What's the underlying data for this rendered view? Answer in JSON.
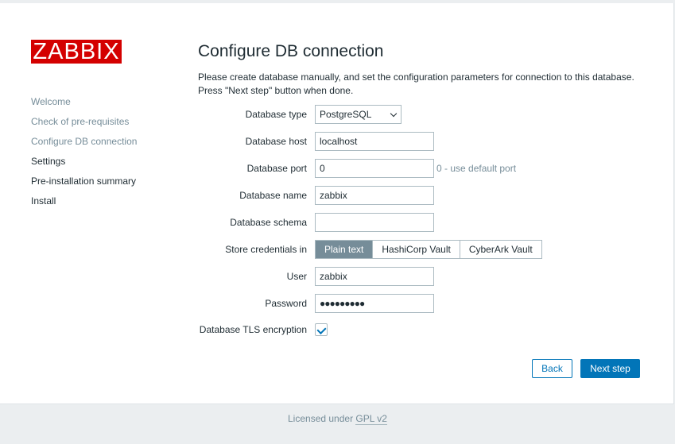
{
  "logo": "ZABBIX",
  "steps": [
    {
      "label": "Welcome",
      "done": true
    },
    {
      "label": "Check of pre-requisites",
      "done": true
    },
    {
      "label": "Configure DB connection",
      "done": true
    },
    {
      "label": "Settings",
      "done": false
    },
    {
      "label": "Pre-installation summary",
      "done": false
    },
    {
      "label": "Install",
      "done": false
    }
  ],
  "title": "Configure DB connection",
  "desc1": "Please create database manually, and set the configuration parameters for connection to this database.",
  "desc2": "Press \"Next step\" button when done.",
  "form": {
    "db_type": {
      "label": "Database type",
      "value": "PostgreSQL"
    },
    "db_host": {
      "label": "Database host",
      "value": "localhost"
    },
    "db_port": {
      "label": "Database port",
      "value": "0",
      "hint": "0 - use default port"
    },
    "db_name": {
      "label": "Database name",
      "value": "zabbix"
    },
    "db_schema": {
      "label": "Database schema",
      "value": ""
    },
    "store": {
      "label": "Store credentials in",
      "options": [
        "Plain text",
        "HashiCorp Vault",
        "CyberArk Vault"
      ],
      "selected": "Plain text"
    },
    "user": {
      "label": "User",
      "value": "zabbix"
    },
    "password": {
      "label": "Password",
      "value": "●●●●●●●●●"
    },
    "tls": {
      "label": "Database TLS encryption",
      "checked": true
    }
  },
  "buttons": {
    "back": "Back",
    "next": "Next step"
  },
  "footer": {
    "text": "Licensed under ",
    "link": "GPL v2"
  },
  "colors": {
    "brand": "#d40000",
    "accent": "#0275b8"
  }
}
